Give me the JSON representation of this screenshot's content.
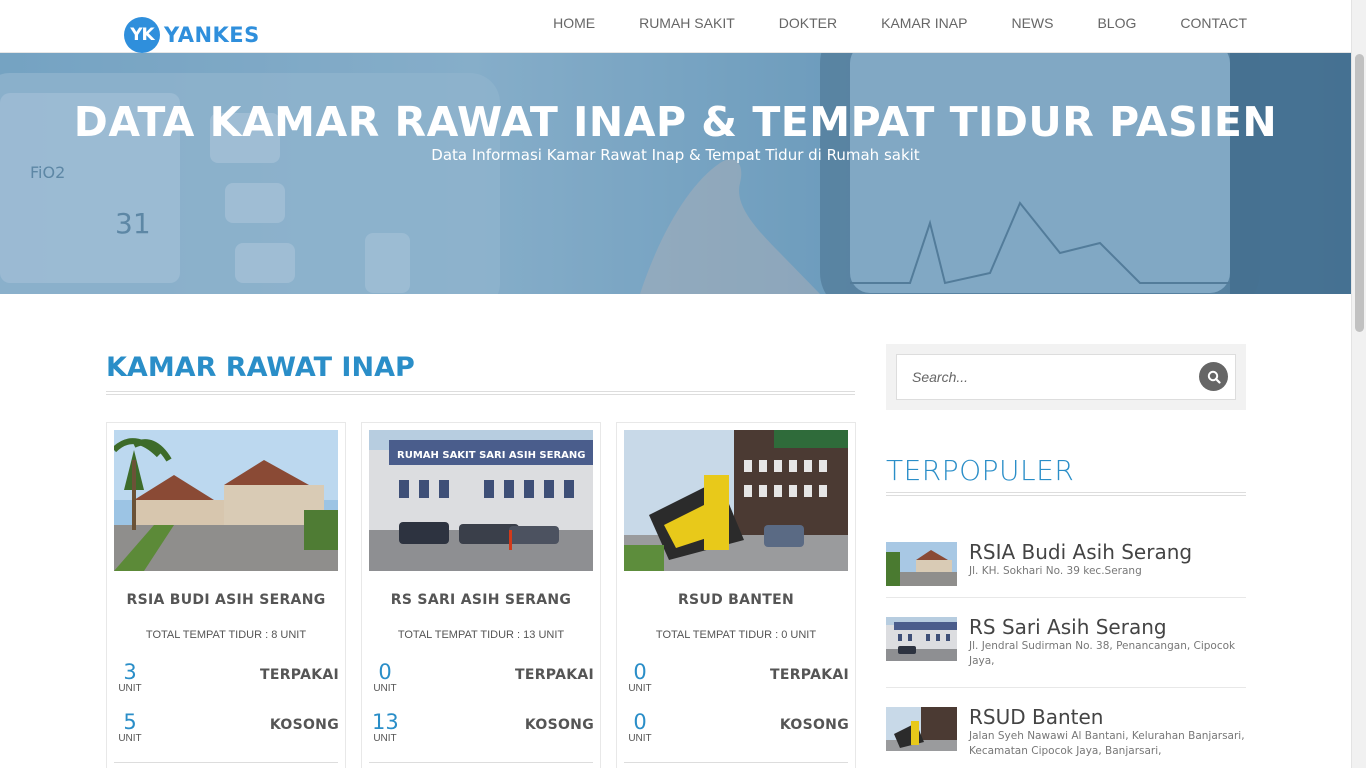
{
  "header": {
    "logo_badge": "YK",
    "logo_text": "YANKES",
    "nav": [
      "HOME",
      "RUMAH SAKIT",
      "DOKTER",
      "KAMAR INAP",
      "NEWS",
      "BLOG",
      "CONTACT"
    ]
  },
  "hero": {
    "title": "DATA KAMAR RAWAT INAP & TEMPAT TIDUR PASIEN",
    "subtitle": "Data Informasi Kamar Rawat Inap & Tempat Tidur di Rumah sakit"
  },
  "main": {
    "section_title": "KAMAR RAWAT INAP",
    "cards": [
      {
        "name": "RSIA BUDI ASIH SERANG",
        "total": "TOTAL TEMPAT TIDUR : 8 UNIT",
        "used": "3",
        "used_unit": "UNIT",
        "used_label": "TERPAKAI",
        "free": "5",
        "free_unit": "UNIT",
        "free_label": "KOSONG"
      },
      {
        "name": "RS SARI ASIH SERANG",
        "total": "TOTAL TEMPAT TIDUR : 13 UNIT",
        "used": "0",
        "used_unit": "UNIT",
        "used_label": "TERPAKAI",
        "free": "13",
        "free_unit": "UNIT",
        "free_label": "KOSONG"
      },
      {
        "name": "RSUD BANTEN",
        "total": "TOTAL TEMPAT TIDUR : 0 UNIT",
        "used": "0",
        "used_unit": "UNIT",
        "used_label": "TERPAKAI",
        "free": "0",
        "free_unit": "UNIT",
        "free_label": "KOSONG"
      }
    ]
  },
  "sidebar": {
    "search_placeholder": "Search...",
    "popular_title": "TERPOPULER",
    "popular": [
      {
        "name": "RSIA Budi Asih Serang",
        "address": "Jl. KH. Sokhari No. 39 kec.Serang"
      },
      {
        "name": "RS Sari Asih Serang",
        "address": "Jl. Jendral Sudirman No. 38, Penancangan, Cipocok Jaya,"
      },
      {
        "name": "RSUD Banten",
        "address": "Jalan Syeh Nawawi Al Bantani, Kelurahan Banjarsari, Kecamatan Cipocok Jaya, Banjarsari,"
      }
    ]
  },
  "colors": {
    "accent": "#2a8ec8",
    "logo": "#2f8fdc"
  }
}
